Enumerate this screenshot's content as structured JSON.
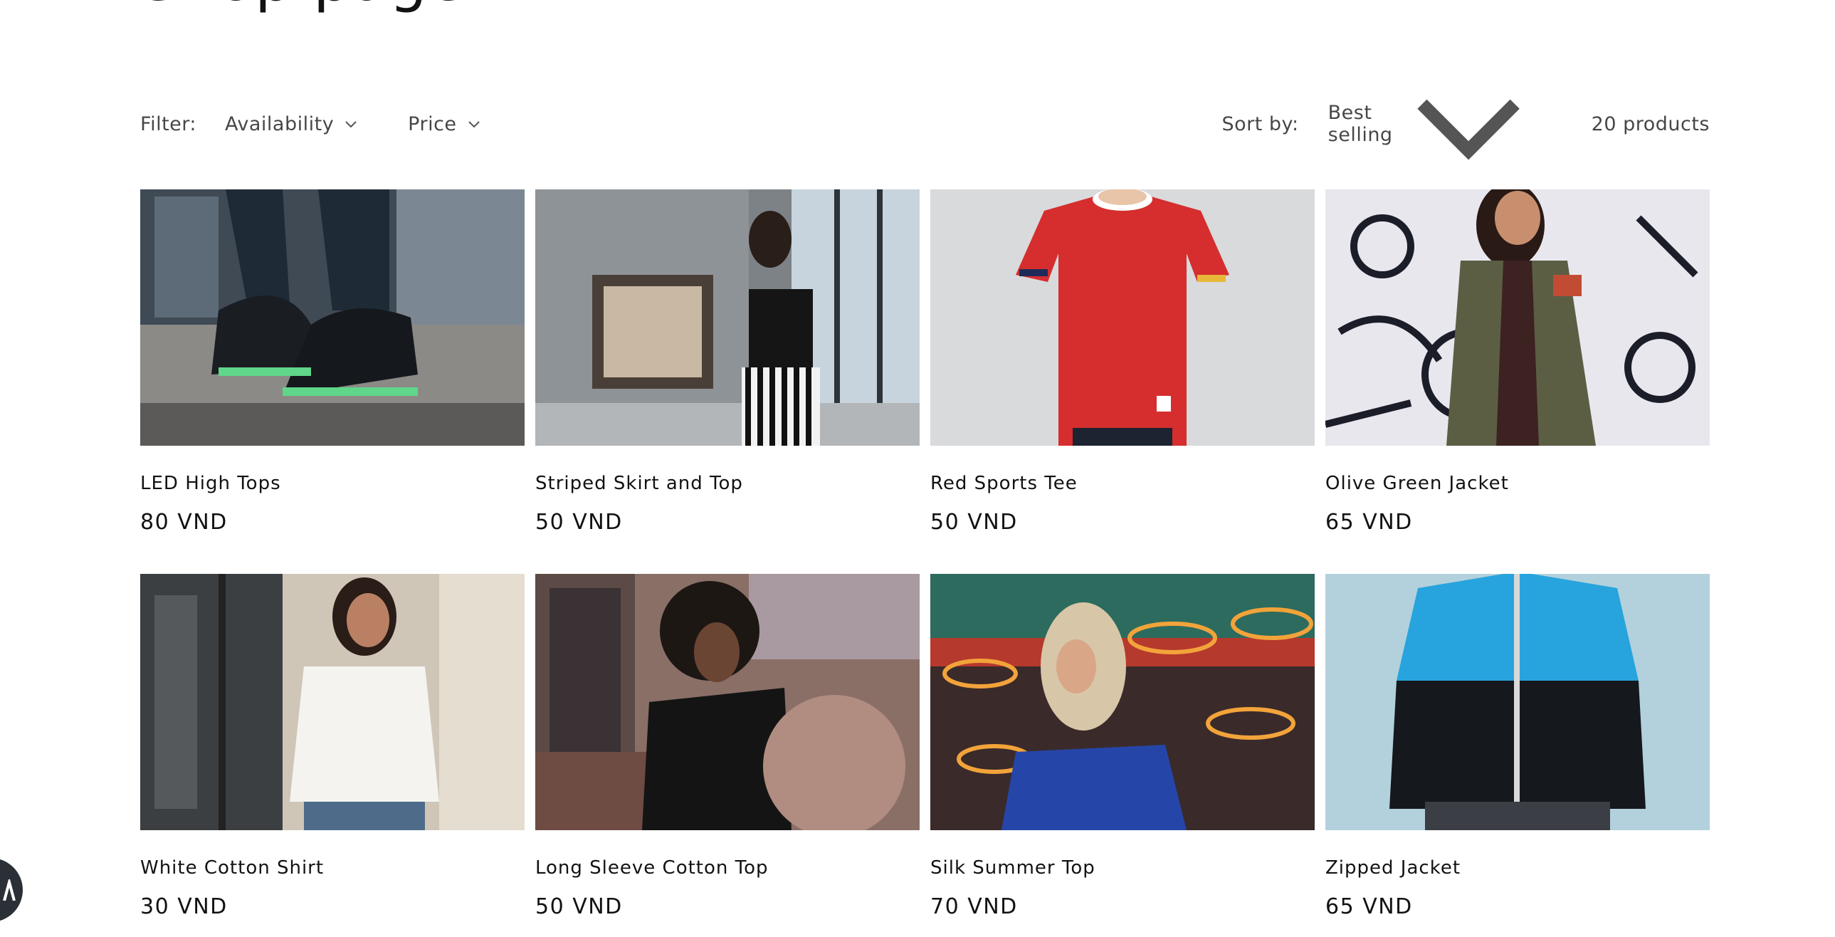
{
  "heading": "Shop page",
  "toolbar": {
    "filter_label": "Filter:",
    "availability_label": "Availability",
    "price_label": "Price",
    "sort_label": "Sort by:",
    "sort_value": "Best selling",
    "product_count": "20 products"
  },
  "products": [
    {
      "title": "LED High Tops",
      "price": "80 VND"
    },
    {
      "title": "Striped Skirt and Top",
      "price": "50 VND"
    },
    {
      "title": "Red Sports Tee",
      "price": "50 VND"
    },
    {
      "title": "Olive Green Jacket",
      "price": "65 VND"
    },
    {
      "title": "White Cotton Shirt",
      "price": "30 VND"
    },
    {
      "title": "Long Sleeve Cotton Top",
      "price": "50 VND"
    },
    {
      "title": "Silk Summer Top",
      "price": "70 VND"
    },
    {
      "title": "Zipped Jacket",
      "price": "65 VND"
    }
  ]
}
